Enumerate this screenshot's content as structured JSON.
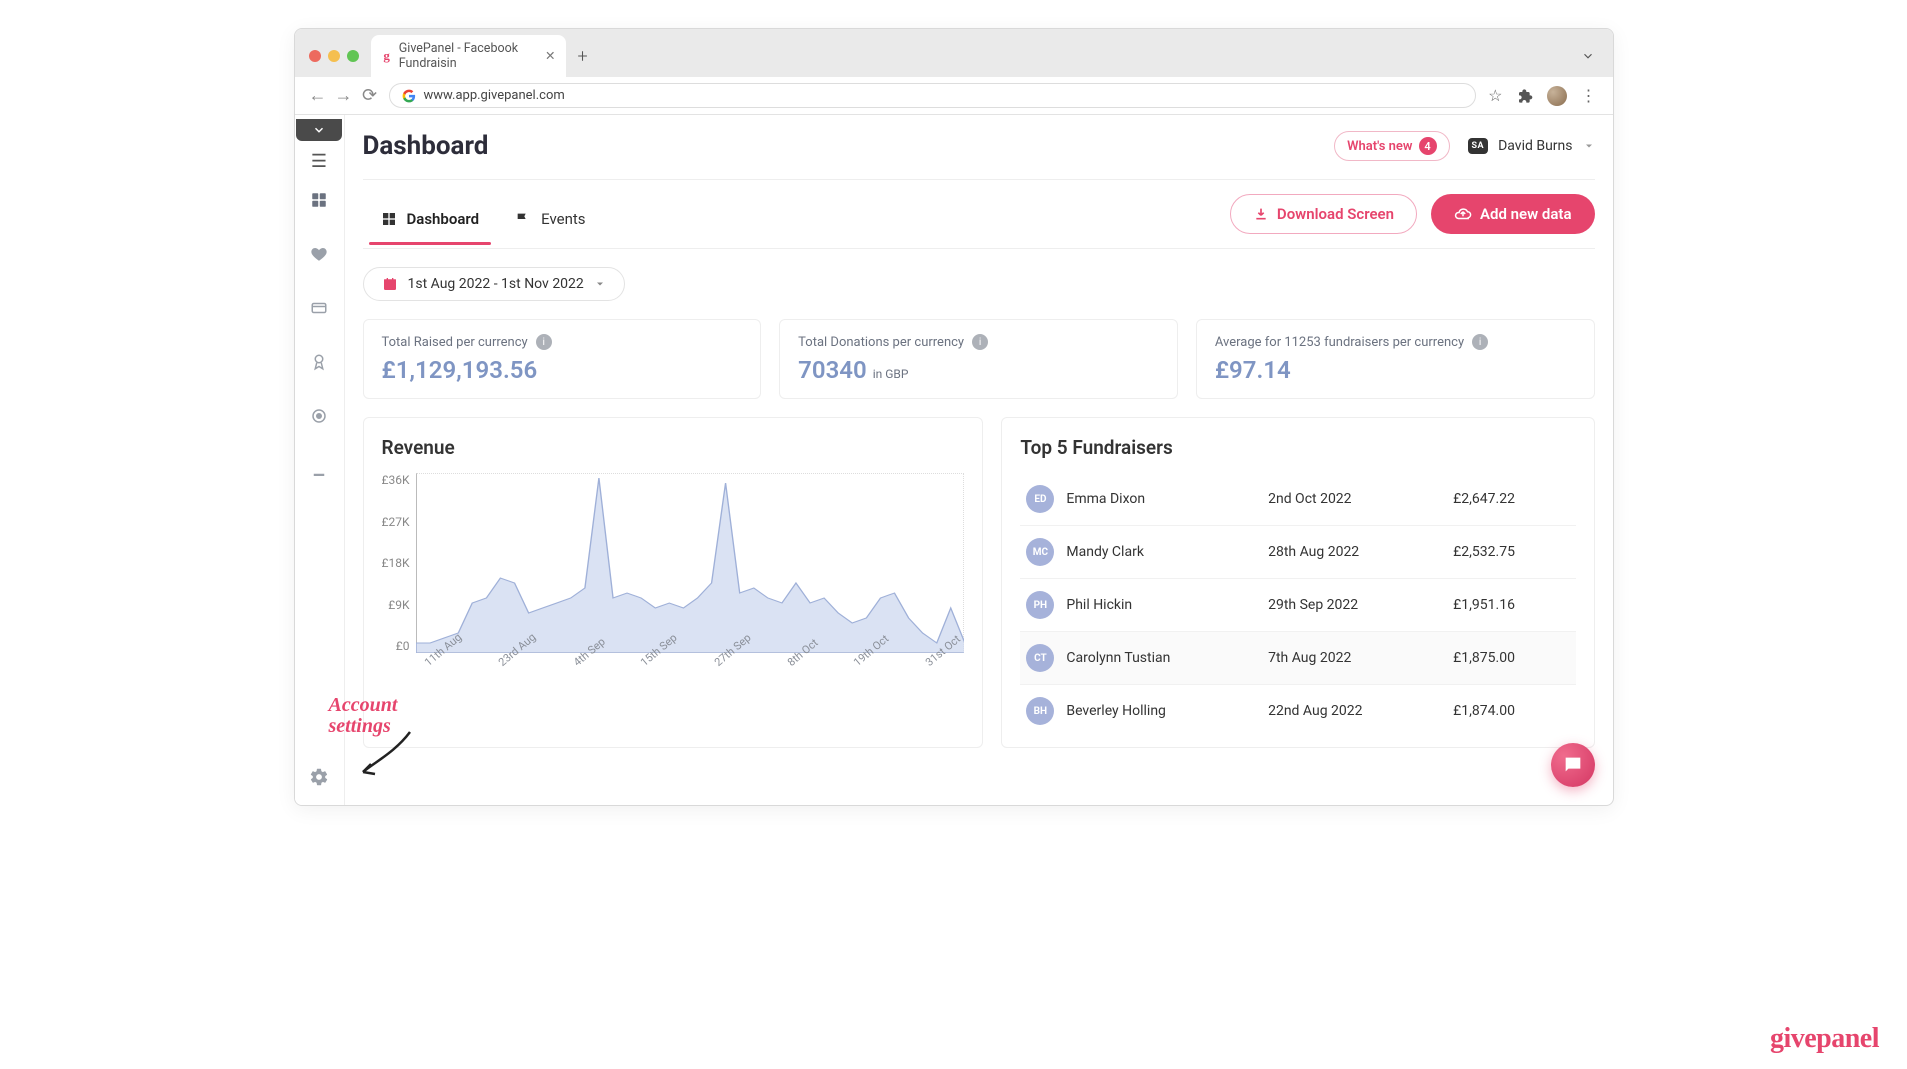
{
  "browser": {
    "tab_title": "GivePanel - Facebook Fundraisin",
    "url": "www.app.givepanel.com"
  },
  "header": {
    "title": "Dashboard",
    "whats_new_label": "What's new",
    "whats_new_count": "4",
    "user_badge": "SA",
    "user_name": "David Burns"
  },
  "tabs": {
    "dashboard": "Dashboard",
    "events": "Events",
    "download_label": "Download Screen",
    "add_data_label": "Add new data"
  },
  "date_range": "1st Aug 2022 - 1st Nov 2022",
  "stats": {
    "raised_label": "Total Raised per currency",
    "raised_value": "£1,129,193.56",
    "donations_label": "Total Donations per currency",
    "donations_value": "70340",
    "donations_sub": "in GBP",
    "avg_label": "Average for 11253 fundraisers per currency",
    "avg_value": "£97.14"
  },
  "revenue_title": "Revenue",
  "top5_title": "Top 5 Fundraisers",
  "fundraisers": [
    {
      "initials": "ED",
      "name": "Emma Dixon",
      "date": "2nd Oct 2022",
      "amount": "£2,647.22"
    },
    {
      "initials": "MC",
      "name": "Mandy Clark",
      "date": "28th Aug 2022",
      "amount": "£2,532.75"
    },
    {
      "initials": "PH",
      "name": "Phil Hickin",
      "date": "29th Sep 2022",
      "amount": "£1,951.16"
    },
    {
      "initials": "CT",
      "name": "Carolynn Tustian",
      "date": "7th Aug 2022",
      "amount": "£1,875.00"
    },
    {
      "initials": "BH",
      "name": "Beverley Holling",
      "date": "22nd Aug 2022",
      "amount": "£1,874.00"
    }
  ],
  "annotation": "Account\nsettings",
  "brand": "givepanel",
  "chart_data": {
    "type": "area",
    "title": "Revenue",
    "ylabel": "",
    "xlabel": "",
    "ylim": [
      0,
      36000
    ],
    "y_ticks": [
      "£36K",
      "£27K",
      "£18K",
      "£9K",
      "£0"
    ],
    "categories": [
      "11th Aug",
      "23rd Aug",
      "4th Sep",
      "15th Sep",
      "27th Sep",
      "8th Oct",
      "19th Oct",
      "31st Oct"
    ],
    "values": [
      2000,
      2000,
      3000,
      4000,
      10000,
      11000,
      15000,
      14000,
      8000,
      9000,
      10000,
      11000,
      13000,
      35000,
      11000,
      12000,
      11000,
      9000,
      10000,
      9000,
      11000,
      14000,
      34000,
      12000,
      13000,
      11000,
      10000,
      14000,
      10000,
      11000,
      8000,
      6000,
      7000,
      11000,
      12000,
      7000,
      4000,
      2000,
      9000,
      2000
    ]
  }
}
